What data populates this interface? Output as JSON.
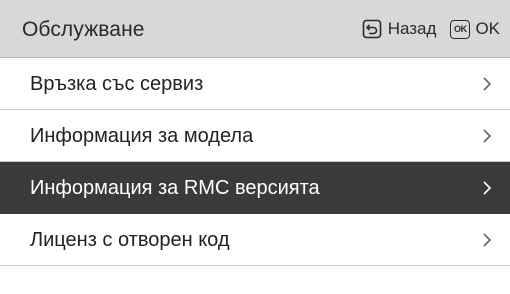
{
  "header": {
    "title": "Обслужване",
    "back_label": "Назад",
    "back_icon": "back-arrow-icon",
    "ok_icon_text": "OK",
    "ok_label": "OK"
  },
  "menu": {
    "items": [
      {
        "label": "Връзка със сервиз",
        "selected": false,
        "icon": "chevron-right-icon"
      },
      {
        "label": "Информация за модела",
        "selected": false,
        "icon": "chevron-right-icon"
      },
      {
        "label": "Информация за RMC версията",
        "selected": true,
        "icon": "chevron-right-icon"
      },
      {
        "label": "Лиценз с отворен код",
        "selected": false,
        "icon": "chevron-right-icon"
      }
    ]
  },
  "colors": {
    "header_bg": "#d8d8d8",
    "selected_bg": "#3a3a3a",
    "divider": "#c9c9c9"
  }
}
